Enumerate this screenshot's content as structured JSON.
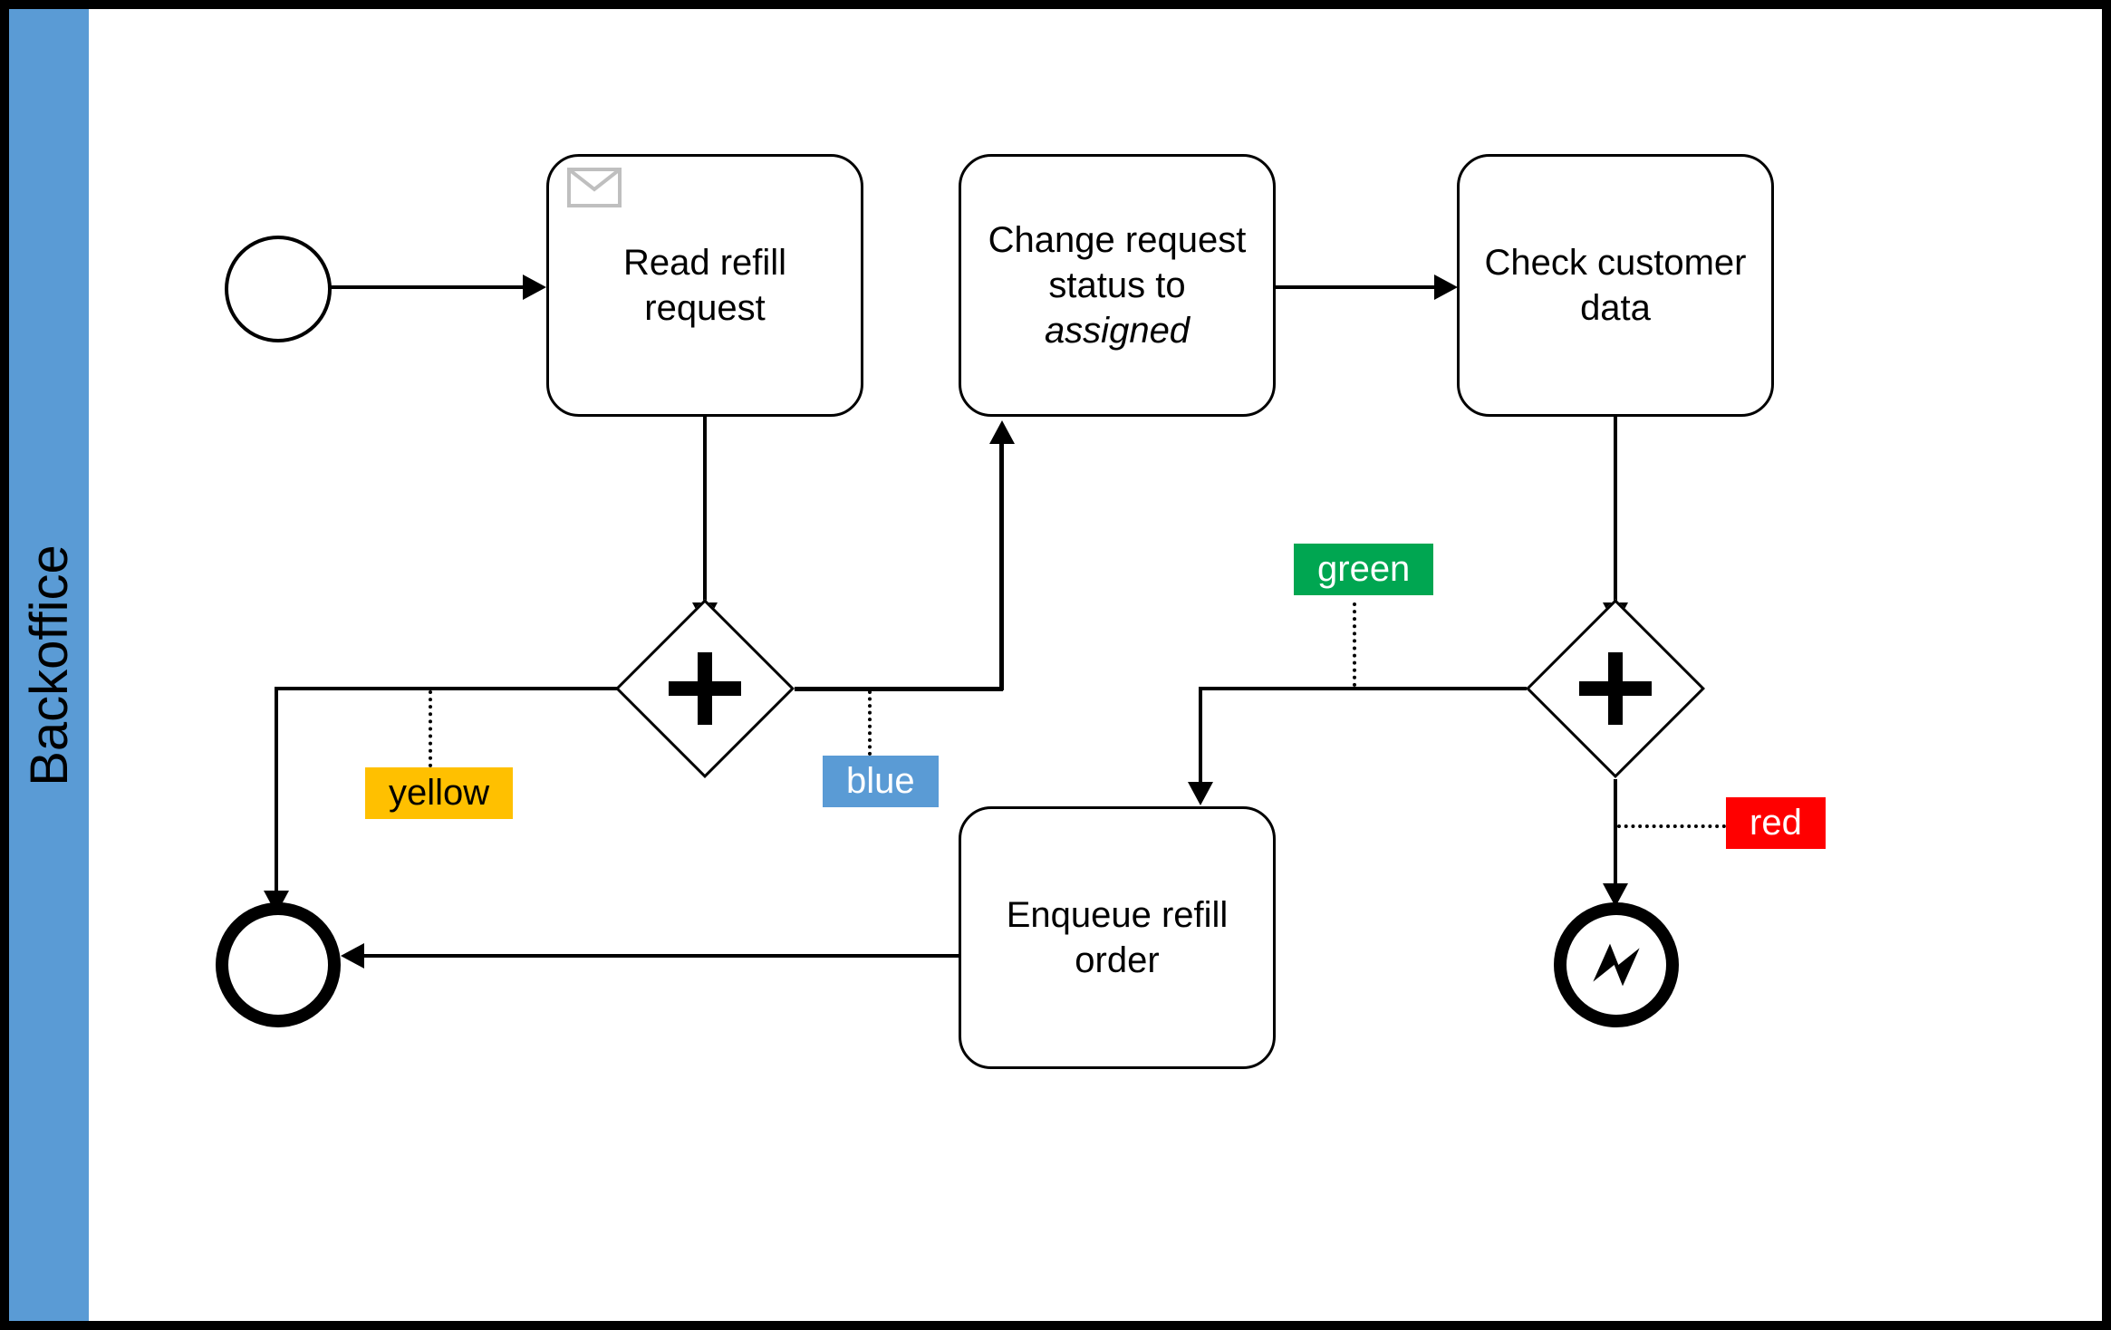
{
  "lane": {
    "title": "Backoffice"
  },
  "tasks": {
    "read_refill": {
      "line1": "Read refill",
      "line2": "request"
    },
    "change_status": {
      "line1": "Change request",
      "line2": "status to",
      "line3": "assigned"
    },
    "check_customer": {
      "line1": "Check customer",
      "line2": "data"
    },
    "enqueue": {
      "line1": "Enqueue refill",
      "line2": "order"
    }
  },
  "tags": {
    "yellow": "yellow",
    "blue": "blue",
    "green": "green",
    "red": "red"
  },
  "icons": {
    "message": "envelope-icon",
    "error": "error-bolt-icon",
    "parallel": "plus-icon"
  },
  "colors": {
    "accent": "#5a9bd5",
    "yellow": "#ffc000",
    "green": "#00a651",
    "red": "#ff0000"
  },
  "chart_data": {
    "type": "bpmn",
    "lane": "Backoffice",
    "nodes": [
      {
        "id": "start",
        "kind": "start-event"
      },
      {
        "id": "t1",
        "kind": "receive-task",
        "label": "Read refill request"
      },
      {
        "id": "g1",
        "kind": "parallel-gateway"
      },
      {
        "id": "end",
        "kind": "end-event"
      },
      {
        "id": "t2",
        "kind": "task",
        "label": "Change request status to assigned"
      },
      {
        "id": "t3",
        "kind": "task",
        "label": "Check customer data"
      },
      {
        "id": "g2",
        "kind": "parallel-gateway"
      },
      {
        "id": "t4",
        "kind": "task",
        "label": "Enqueue refill order"
      },
      {
        "id": "err",
        "kind": "error-end-event"
      }
    ],
    "flows": [
      {
        "from": "start",
        "to": "t1"
      },
      {
        "from": "t1",
        "to": "g1"
      },
      {
        "from": "g1",
        "to": "end",
        "annotation": "yellow"
      },
      {
        "from": "g1",
        "to": "t2",
        "annotation": "blue"
      },
      {
        "from": "t2",
        "to": "t3"
      },
      {
        "from": "t3",
        "to": "g2"
      },
      {
        "from": "g2",
        "to": "t4",
        "annotation": "green"
      },
      {
        "from": "g2",
        "to": "err",
        "annotation": "red"
      },
      {
        "from": "t4",
        "to": "end"
      }
    ]
  }
}
